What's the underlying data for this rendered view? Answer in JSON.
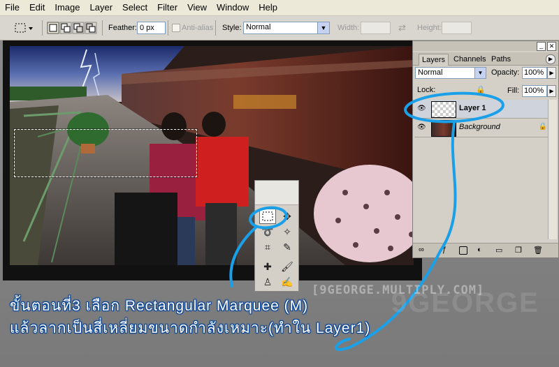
{
  "menu": {
    "items": [
      "File",
      "Edit",
      "Image",
      "Layer",
      "Select",
      "Filter",
      "View",
      "Window",
      "Help"
    ]
  },
  "options_bar": {
    "feather_label": "Feather:",
    "feather_value": "0 px",
    "antialias_label": "Anti-alias",
    "style_label": "Style:",
    "style_value": "Normal",
    "width_label": "Width:",
    "height_label": "Height:"
  },
  "layers_panel": {
    "tabs": [
      "Layers",
      "Channels",
      "Paths"
    ],
    "blend_mode": "Normal",
    "opacity_label": "Opacity:",
    "opacity_value": "100%",
    "lock_label": "Lock:",
    "fill_label": "Fill:",
    "fill_value": "100%",
    "layers": [
      {
        "name": "Layer 1"
      },
      {
        "name": "Background"
      }
    ]
  },
  "caption": {
    "line1": "ขั้นตอนที่3  เลือก Rectangular Marquee (M)",
    "line2": "แล้วลากเป็นสี่เหลี่ยมขนาดกำลังเหมาะ(ทำใน Layer1)"
  },
  "watermark": {
    "main": "[9GEORGE.MULTIPLY.COM]",
    "large": "9GEORGE"
  },
  "colors": {
    "annotation": "#1aa0e8",
    "selected_layer": "#cfd4dc"
  }
}
